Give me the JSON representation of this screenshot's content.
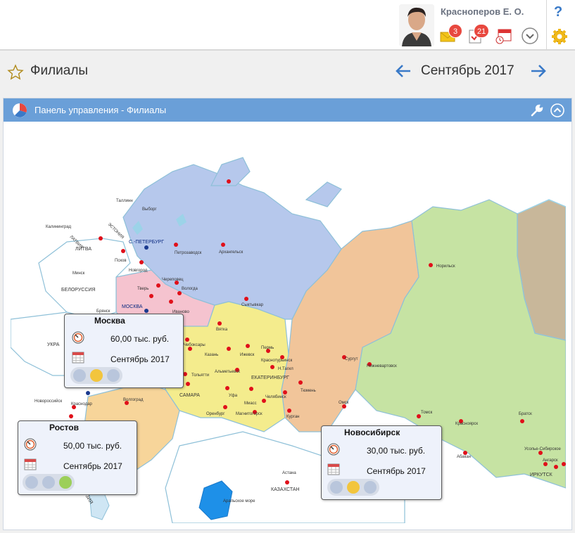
{
  "header": {
    "user_name": "Красноперов Е. О.",
    "mail_badge": "3",
    "tasks_badge": "21",
    "help_label": "?"
  },
  "page": {
    "title": "Филиалы",
    "month": "Сентябрь 2017"
  },
  "panel": {
    "title": "Панель управления - Филиалы"
  },
  "map_labels": {
    "tallinn": "Таллинн",
    "vyborg": "Выборг",
    "estonia": "ЭСТОНИЯ",
    "latvia": "ЛАТВИЯ",
    "lithuania": "ЛИТВА",
    "kaliningrad": "Калининград",
    "spb": "С.-ПЕТЕРБУРГ",
    "pskov": "Псков",
    "novgorod": "Новгород",
    "petrozavodsk": "Петрозаводск",
    "arkhangelsk": "Архангельск",
    "minsk": "Минск",
    "belarus": "БЕЛОРУССИЯ",
    "tver": "Тверь",
    "vologda": "Вологда",
    "cherepovets": "Череповец",
    "moscow_map": "МОСКВА",
    "ivanovo": "Иваново",
    "bryansk": "Брянск",
    "syktyvkar": "Сыктывкар",
    "vyatka": "Вятка",
    "cheboksary": "Чебоксары",
    "kazan": "Казань",
    "izhevsk": "Ижевск",
    "perm": "Пермь",
    "krasnoturinsk": "Краснотурьинск",
    "ntagil": "Н.Тагил",
    "ekaterinburg": "ЕКАТЕРИНБУРГ",
    "tolyatti": "Тольятти",
    "almetyevsk": "Альметьевск",
    "ufa": "Уфа",
    "miass": "Миасс",
    "chelyabinsk": "Челябинск",
    "tyumen": "Тюмень",
    "kurgan": "Курган",
    "samara": "САМАРА",
    "orenburg": "Оренбург",
    "magnitogorsk": "Магнитогорск",
    "volgograd": "Волгоград",
    "krasnodar": "Краснодар",
    "novorossiysk": "Новороссийск",
    "ukraine": "УКРА",
    "surgut": "Сургут",
    "nizhnevartovsk": "Нижневартовск",
    "norilsk": "Норильск",
    "omsk": "Омск",
    "tomsk": "Томск",
    "krasnoyarsk": "Красноярск",
    "bratsk": "Братск",
    "abakan": "Абакан",
    "usolye": "Усолье-Сибирское",
    "angarsk": "Ангарск",
    "irkutsk": "ИРКУТСК",
    "astana": "Астана",
    "kazakhstan": "КАЗАХСТАН",
    "aral": "Аральское море",
    "gruzia": "ГРУЗИЯ"
  },
  "branches": [
    {
      "name": "Москва",
      "value": "60,00 тыс. руб.",
      "date": "Сентябрь 2017",
      "status": "yellow"
    },
    {
      "name": "Ростов",
      "value": "50,00 тыс. руб.",
      "date": "Сентябрь 2017",
      "status": "green"
    },
    {
      "name": "Новосибирск",
      "value": "30,00 тыс. руб.",
      "date": "Сентябрь 2017",
      "status": "yellow"
    }
  ],
  "colors": {
    "panel_header": "#6a9fd8",
    "accent_blue": "#3a7ac8",
    "badge_red": "#e8483f",
    "light_yellow": "#f2c53d",
    "light_green": "#9ccf5a",
    "light_off": "#b9c6dc"
  }
}
